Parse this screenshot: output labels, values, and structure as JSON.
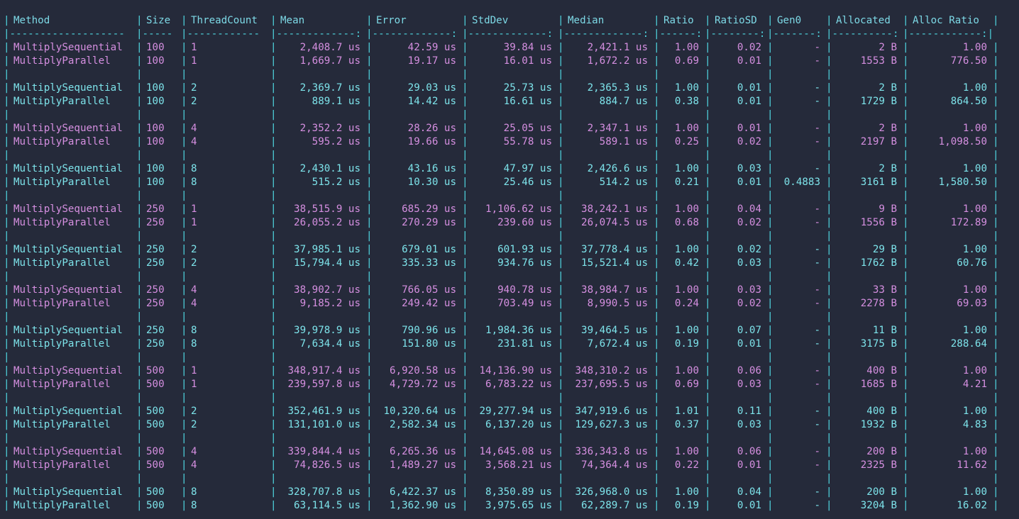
{
  "columns": [
    {
      "key": "method",
      "label": "Method"
    },
    {
      "key": "size",
      "label": "Size"
    },
    {
      "key": "threads",
      "label": "ThreadCount"
    },
    {
      "key": "mean",
      "label": "Mean"
    },
    {
      "key": "error",
      "label": "Error"
    },
    {
      "key": "stddev",
      "label": "StdDev"
    },
    {
      "key": "median",
      "label": "Median"
    },
    {
      "key": "ratio",
      "label": "Ratio"
    },
    {
      "key": "ratiosd",
      "label": "RatioSD"
    },
    {
      "key": "gen0",
      "label": "Gen0"
    },
    {
      "key": "allocated",
      "label": "Allocated"
    },
    {
      "key": "allocratio",
      "label": "Alloc Ratio"
    }
  ],
  "separator": [
    "|-------------------",
    "|-----",
    "|------------",
    "|-------------:",
    "|-------------:",
    "|-------------:",
    "|-------------:",
    "|------:",
    "|--------:",
    "|-------:",
    "|----------:",
    "|------------:|"
  ],
  "colors": {
    "magenta": "#d58fe0",
    "cyan": "#7de3ea",
    "pipe": "#4fd6e0",
    "background": "#252a3a"
  },
  "rows": [
    {
      "method": "MultiplySequential",
      "size": "100",
      "threads": "1",
      "mean": "2,408.7 us",
      "error": "42.59 us",
      "stddev": "39.84 us",
      "median": "2,421.1 us",
      "ratio": "1.00",
      "ratiosd": "0.02",
      "gen0": "-",
      "allocated": "2 B",
      "allocratio": "1.00"
    },
    {
      "method": "MultiplyParallel",
      "size": "100",
      "threads": "1",
      "mean": "1,669.7 us",
      "error": "19.17 us",
      "stddev": "16.01 us",
      "median": "1,672.2 us",
      "ratio": "0.69",
      "ratiosd": "0.01",
      "gen0": "-",
      "allocated": "1553 B",
      "allocratio": "776.50"
    },
    {
      "method": "MultiplySequential",
      "size": "100",
      "threads": "2",
      "mean": "2,369.7 us",
      "error": "29.03 us",
      "stddev": "25.73 us",
      "median": "2,365.3 us",
      "ratio": "1.00",
      "ratiosd": "0.01",
      "gen0": "-",
      "allocated": "2 B",
      "allocratio": "1.00"
    },
    {
      "method": "MultiplyParallel",
      "size": "100",
      "threads": "2",
      "mean": "889.1 us",
      "error": "14.42 us",
      "stddev": "16.61 us",
      "median": "884.7 us",
      "ratio": "0.38",
      "ratiosd": "0.01",
      "gen0": "-",
      "allocated": "1729 B",
      "allocratio": "864.50"
    },
    {
      "method": "MultiplySequential",
      "size": "100",
      "threads": "4",
      "mean": "2,352.2 us",
      "error": "28.26 us",
      "stddev": "25.05 us",
      "median": "2,347.1 us",
      "ratio": "1.00",
      "ratiosd": "0.01",
      "gen0": "-",
      "allocated": "2 B",
      "allocratio": "1.00"
    },
    {
      "method": "MultiplyParallel",
      "size": "100",
      "threads": "4",
      "mean": "595.2 us",
      "error": "19.66 us",
      "stddev": "55.78 us",
      "median": "589.1 us",
      "ratio": "0.25",
      "ratiosd": "0.02",
      "gen0": "-",
      "allocated": "2197 B",
      "allocratio": "1,098.50"
    },
    {
      "method": "MultiplySequential",
      "size": "100",
      "threads": "8",
      "mean": "2,430.1 us",
      "error": "43.16 us",
      "stddev": "47.97 us",
      "median": "2,426.6 us",
      "ratio": "1.00",
      "ratiosd": "0.03",
      "gen0": "-",
      "allocated": "2 B",
      "allocratio": "1.00"
    },
    {
      "method": "MultiplyParallel",
      "size": "100",
      "threads": "8",
      "mean": "515.2 us",
      "error": "10.30 us",
      "stddev": "25.46 us",
      "median": "514.2 us",
      "ratio": "0.21",
      "ratiosd": "0.01",
      "gen0": "0.4883",
      "allocated": "3161 B",
      "allocratio": "1,580.50"
    },
    {
      "method": "MultiplySequential",
      "size": "250",
      "threads": "1",
      "mean": "38,515.9 us",
      "error": "685.29 us",
      "stddev": "1,106.62 us",
      "median": "38,242.1 us",
      "ratio": "1.00",
      "ratiosd": "0.04",
      "gen0": "-",
      "allocated": "9 B",
      "allocratio": "1.00"
    },
    {
      "method": "MultiplyParallel",
      "size": "250",
      "threads": "1",
      "mean": "26,055.2 us",
      "error": "270.29 us",
      "stddev": "239.60 us",
      "median": "26,074.5 us",
      "ratio": "0.68",
      "ratiosd": "0.02",
      "gen0": "-",
      "allocated": "1556 B",
      "allocratio": "172.89"
    },
    {
      "method": "MultiplySequential",
      "size": "250",
      "threads": "2",
      "mean": "37,985.1 us",
      "error": "679.01 us",
      "stddev": "601.93 us",
      "median": "37,778.4 us",
      "ratio": "1.00",
      "ratiosd": "0.02",
      "gen0": "-",
      "allocated": "29 B",
      "allocratio": "1.00"
    },
    {
      "method": "MultiplyParallel",
      "size": "250",
      "threads": "2",
      "mean": "15,794.4 us",
      "error": "335.33 us",
      "stddev": "934.76 us",
      "median": "15,521.4 us",
      "ratio": "0.42",
      "ratiosd": "0.03",
      "gen0": "-",
      "allocated": "1762 B",
      "allocratio": "60.76"
    },
    {
      "method": "MultiplySequential",
      "size": "250",
      "threads": "4",
      "mean": "38,902.7 us",
      "error": "766.05 us",
      "stddev": "940.78 us",
      "median": "38,984.7 us",
      "ratio": "1.00",
      "ratiosd": "0.03",
      "gen0": "-",
      "allocated": "33 B",
      "allocratio": "1.00"
    },
    {
      "method": "MultiplyParallel",
      "size": "250",
      "threads": "4",
      "mean": "9,185.2 us",
      "error": "249.42 us",
      "stddev": "703.49 us",
      "median": "8,990.5 us",
      "ratio": "0.24",
      "ratiosd": "0.02",
      "gen0": "-",
      "allocated": "2278 B",
      "allocratio": "69.03"
    },
    {
      "method": "MultiplySequential",
      "size": "250",
      "threads": "8",
      "mean": "39,978.9 us",
      "error": "790.96 us",
      "stddev": "1,984.36 us",
      "median": "39,464.5 us",
      "ratio": "1.00",
      "ratiosd": "0.07",
      "gen0": "-",
      "allocated": "11 B",
      "allocratio": "1.00"
    },
    {
      "method": "MultiplyParallel",
      "size": "250",
      "threads": "8",
      "mean": "7,634.4 us",
      "error": "151.80 us",
      "stddev": "231.81 us",
      "median": "7,672.4 us",
      "ratio": "0.19",
      "ratiosd": "0.01",
      "gen0": "-",
      "allocated": "3175 B",
      "allocratio": "288.64"
    },
    {
      "method": "MultiplySequential",
      "size": "500",
      "threads": "1",
      "mean": "348,917.4 us",
      "error": "6,920.58 us",
      "stddev": "14,136.90 us",
      "median": "348,310.2 us",
      "ratio": "1.00",
      "ratiosd": "0.06",
      "gen0": "-",
      "allocated": "400 B",
      "allocratio": "1.00"
    },
    {
      "method": "MultiplyParallel",
      "size": "500",
      "threads": "1",
      "mean": "239,597.8 us",
      "error": "4,729.72 us",
      "stddev": "6,783.22 us",
      "median": "237,695.5 us",
      "ratio": "0.69",
      "ratiosd": "0.03",
      "gen0": "-",
      "allocated": "1685 B",
      "allocratio": "4.21"
    },
    {
      "method": "MultiplySequential",
      "size": "500",
      "threads": "2",
      "mean": "352,461.9 us",
      "error": "10,320.64 us",
      "stddev": "29,277.94 us",
      "median": "347,919.6 us",
      "ratio": "1.01",
      "ratiosd": "0.11",
      "gen0": "-",
      "allocated": "400 B",
      "allocratio": "1.00"
    },
    {
      "method": "MultiplyParallel",
      "size": "500",
      "threads": "2",
      "mean": "131,101.0 us",
      "error": "2,582.34 us",
      "stddev": "6,137.20 us",
      "median": "129,627.3 us",
      "ratio": "0.37",
      "ratiosd": "0.03",
      "gen0": "-",
      "allocated": "1932 B",
      "allocratio": "4.83"
    },
    {
      "method": "MultiplySequential",
      "size": "500",
      "threads": "4",
      "mean": "339,844.4 us",
      "error": "6,265.36 us",
      "stddev": "14,645.08 us",
      "median": "336,343.8 us",
      "ratio": "1.00",
      "ratiosd": "0.06",
      "gen0": "-",
      "allocated": "200 B",
      "allocratio": "1.00"
    },
    {
      "method": "MultiplyParallel",
      "size": "500",
      "threads": "4",
      "mean": "74,826.5 us",
      "error": "1,489.27 us",
      "stddev": "3,568.21 us",
      "median": "74,364.4 us",
      "ratio": "0.22",
      "ratiosd": "0.01",
      "gen0": "-",
      "allocated": "2325 B",
      "allocratio": "11.62"
    },
    {
      "method": "MultiplySequential",
      "size": "500",
      "threads": "8",
      "mean": "328,707.8 us",
      "error": "6,422.37 us",
      "stddev": "8,350.89 us",
      "median": "326,968.0 us",
      "ratio": "1.00",
      "ratiosd": "0.04",
      "gen0": "-",
      "allocated": "200 B",
      "allocratio": "1.00"
    },
    {
      "method": "MultiplyParallel",
      "size": "500",
      "threads": "8",
      "mean": "63,114.5 us",
      "error": "1,362.90 us",
      "stddev": "3,975.65 us",
      "median": "62,289.7 us",
      "ratio": "0.19",
      "ratiosd": "0.01",
      "gen0": "-",
      "allocated": "3204 B",
      "allocratio": "16.02"
    }
  ]
}
